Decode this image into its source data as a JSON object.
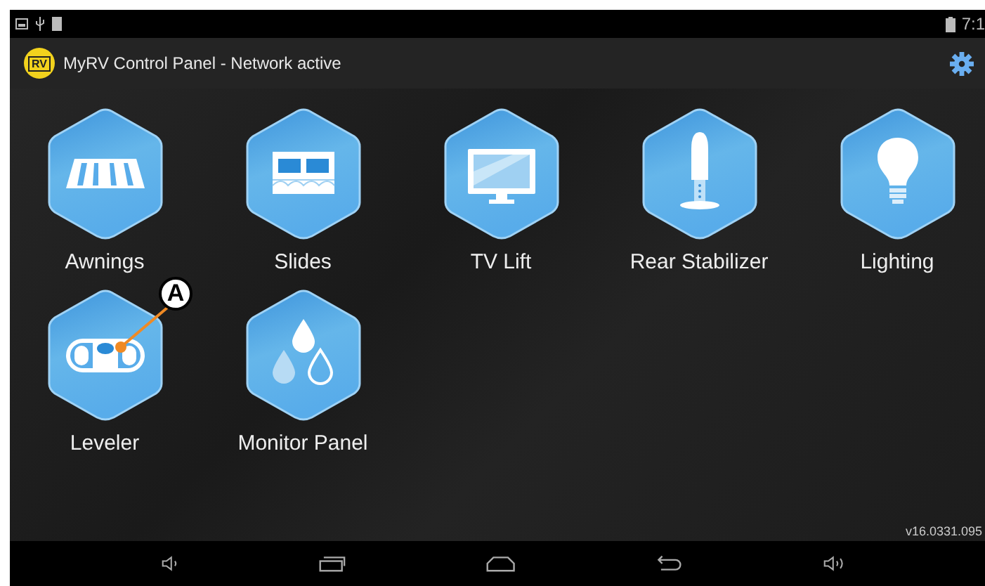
{
  "status_bar": {
    "time": "7:1"
  },
  "app_bar": {
    "logo_text": "RV",
    "title": "MyRV Control Panel - Network active"
  },
  "tiles": [
    {
      "label": "Awnings",
      "kind": "awning"
    },
    {
      "label": "Slides",
      "kind": "slides"
    },
    {
      "label": "TV Lift",
      "kind": "tv"
    },
    {
      "label": "Rear Stabilizer",
      "kind": "stabilizer"
    },
    {
      "label": "Lighting",
      "kind": "bulb"
    },
    {
      "label": "Leveler",
      "kind": "level"
    },
    {
      "label": "Monitor Panel",
      "kind": "drops"
    }
  ],
  "callout": {
    "label": "A"
  },
  "version": "v16.0331.095"
}
